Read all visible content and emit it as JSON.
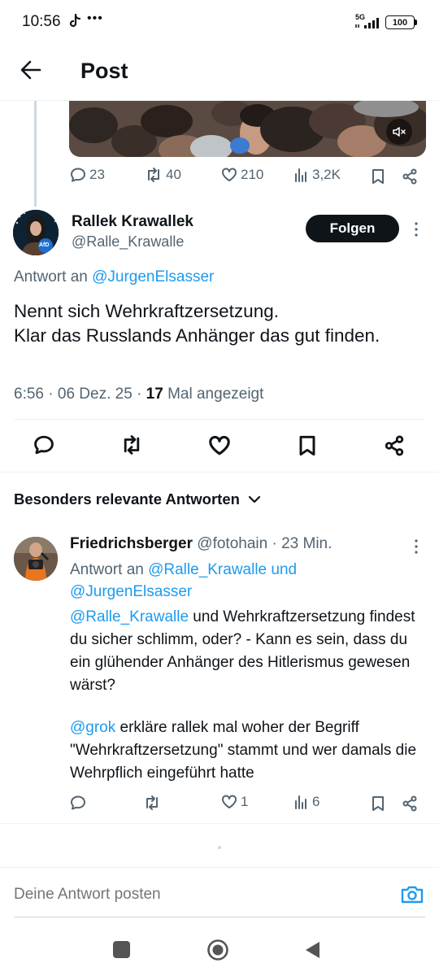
{
  "status_bar": {
    "time": "10:56",
    "dots": "•••",
    "network": "5G",
    "battery": "100"
  },
  "header": {
    "title": "Post"
  },
  "prev_tweet_stats": {
    "replies": "23",
    "reposts": "40",
    "likes": "210",
    "views": "3,2K"
  },
  "main_tweet": {
    "author_name": "Rallek Krawallek",
    "author_handle": "@Ralle_Krawalle",
    "follow_label": "Folgen",
    "reply_prefix": "Antwort an",
    "reply_to": "@JurgenElsasser",
    "text": "Nennt sich Wehrkraftzersetzung.\nKlar das Russlands Anhänger das gut finden.",
    "time": "6:56",
    "date": "06 Dez. 25",
    "view_count": "17",
    "view_label": "Mal angezeigt",
    "avatar_badge": "AfD"
  },
  "replies_section": {
    "title": "Besonders relevante Antworten"
  },
  "reply": {
    "author_name": "Friedrichsberger",
    "author_handle": "@fotohain",
    "time": "23 Min.",
    "reply_prefix": "Antwort an",
    "reply_to_1": "@Ralle_Krawalle",
    "and": "und",
    "reply_to_2": "@JurgenElsasser",
    "mention_1": "@Ralle_Krawalle",
    "text_1": " und Wehrkraftzersetzung findest du sicher schlimm, oder? - Kann es sein, dass du ein glühender Anhänger des Hitlerismus gewesen wärst?",
    "mention_2": "@grok",
    "text_2": " erkläre rallek mal woher der Begriff \"Wehrkraftzersetzung\" stammt und wer damals die Wehrpflich eingeführt hatte",
    "likes": "1",
    "views": "6"
  },
  "compose": {
    "placeholder": "Deine Antwort posten"
  }
}
